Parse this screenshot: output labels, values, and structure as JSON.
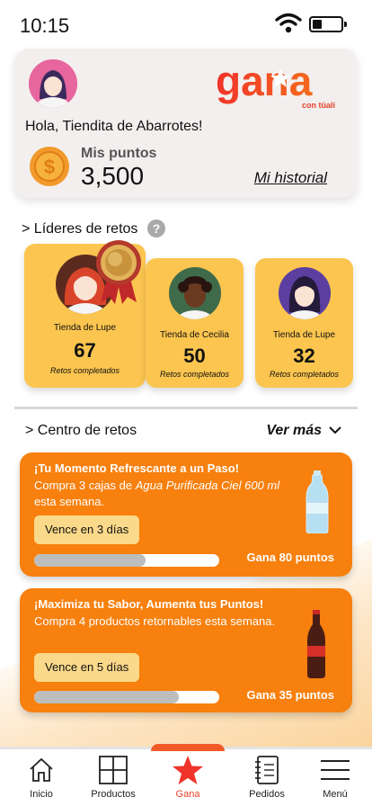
{
  "status_bar": {
    "time": "10:15"
  },
  "header": {
    "brand": {
      "name": "gana",
      "tagline": "con tüali"
    },
    "greeting": "Hola, Tiendita de Abarrotes!",
    "points_label": "Mis puntos",
    "points_value": "3,500",
    "history_link": "Mi historial"
  },
  "leaders": {
    "title": "> Líderes de retos",
    "help": "?",
    "items": [
      {
        "name": "Tienda de Lupe",
        "score": "67",
        "subtitle": "Retos completados"
      },
      {
        "name": "Tienda de Cecilia",
        "score": "50",
        "subtitle": "Retos completados"
      },
      {
        "name": "Tienda de Lupe",
        "score": "32",
        "subtitle": "Retos completados"
      }
    ]
  },
  "challenges": {
    "title": "> Centro de retos",
    "see_more": "Ver más",
    "items": [
      {
        "title": "¡Tu Momento Refrescante a un Paso!",
        "desc_before": "Compra 3 cajas de ",
        "desc_emphasis": "Agua Purificada Ciel 600 ml",
        "desc_after": " esta semana.",
        "expiry": "Vence en 3 días",
        "progress": 0.6,
        "reward": "Gana 80 puntos"
      },
      {
        "title": "¡Maximiza tu Sabor, Aumenta tus Puntos!",
        "desc_before": "Compra 4 productos retornables esta semana.",
        "desc_emphasis": "",
        "desc_after": "",
        "expiry": "Vence en 5 días",
        "progress": 0.78,
        "reward": "Gana 35 puntos"
      }
    ]
  },
  "nav": {
    "items": [
      {
        "label": "Inicio",
        "icon": "home-icon"
      },
      {
        "label": "Productos",
        "icon": "grid-icon"
      },
      {
        "label": "Gana",
        "icon": "star-icon",
        "active": true
      },
      {
        "label": "Pedidos",
        "icon": "notebook-icon"
      },
      {
        "label": "Menú",
        "icon": "menu-icon"
      }
    ]
  },
  "colors": {
    "accent": "#f7800e",
    "leader_card": "#fbc54f",
    "brand_red": "#f0342a"
  }
}
